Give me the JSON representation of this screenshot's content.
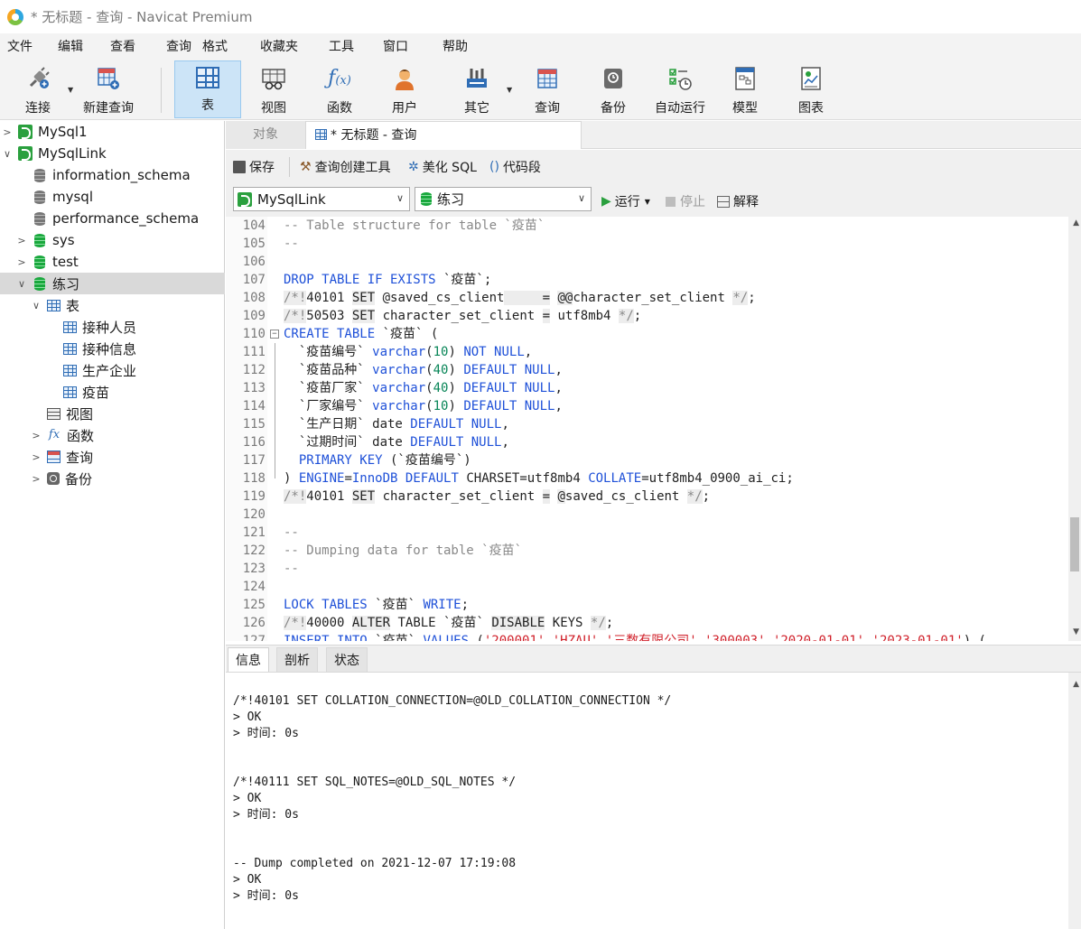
{
  "window": {
    "title": "* 无标题 - 查询 - Navicat Premium"
  },
  "menu": [
    "文件",
    "编辑",
    "查看",
    "查询",
    "格式",
    "收藏夹",
    "工具",
    "窗口",
    "帮助"
  ],
  "toolbar": {
    "connect": "连接",
    "new_query": "新建查询",
    "table": "表",
    "view": "视图",
    "function": "函数",
    "user": "用户",
    "other": "其它",
    "query": "查询",
    "backup": "备份",
    "auto_run": "自动运行",
    "model": "模型",
    "chart": "图表",
    "active": "表"
  },
  "tree": [
    {
      "label": "MySql1",
      "icon": "connection-icon",
      "expanded": false
    },
    {
      "label": "MySqlLink",
      "icon": "connection-icon",
      "expanded": true
    },
    {
      "label": "information_schema",
      "icon": "database-icon"
    },
    {
      "label": "mysql",
      "icon": "database-icon"
    },
    {
      "label": "performance_schema",
      "icon": "database-icon"
    },
    {
      "label": "sys",
      "icon": "database-active-icon",
      "expanded": false
    },
    {
      "label": "test",
      "icon": "database-active-icon",
      "expanded": false
    },
    {
      "label": "练习",
      "icon": "database-active-icon",
      "expanded": true,
      "selected": true
    },
    {
      "label": "表",
      "icon": "tables-icon",
      "expanded": true
    },
    {
      "label": "接种人员",
      "icon": "table-icon"
    },
    {
      "label": "接种信息",
      "icon": "table-icon"
    },
    {
      "label": "生产企业",
      "icon": "table-icon"
    },
    {
      "label": "疫苗",
      "icon": "table-icon"
    },
    {
      "label": "视图",
      "icon": "views-icon"
    },
    {
      "label": "函数",
      "icon": "function-icon",
      "expanded": false
    },
    {
      "label": "查询",
      "icon": "query-icon",
      "expanded": false
    },
    {
      "label": "备份",
      "icon": "backup-icon",
      "expanded": false
    }
  ],
  "tabs": {
    "objects": "对象",
    "query_tab": "* 无标题 - 查询"
  },
  "editor_toolbar": {
    "save": "保存",
    "query_builder": "查询创建工具",
    "beautify": "美化 SQL",
    "snippet": "代码段"
  },
  "selectors": {
    "connection": "MySqlLink",
    "database": "练习",
    "run": "运行",
    "stop": "停止",
    "explain": "解释"
  },
  "code_lines": [
    {
      "n": "104",
      "text": "-- Table structure for table `疫苗`"
    },
    {
      "n": "105",
      "text": "--"
    },
    {
      "n": "106",
      "text": ""
    },
    {
      "n": "107",
      "text": "DROP TABLE IF EXISTS `疫苗`;"
    },
    {
      "n": "108",
      "text": "/*!40101 SET @saved_cs_client     = @@character_set_client */;"
    },
    {
      "n": "109",
      "text": "/*!50503 SET character_set_client = utf8mb4 */;"
    },
    {
      "n": "110",
      "text": "CREATE TABLE `疫苗` ("
    },
    {
      "n": "111",
      "text": "  `疫苗编号` varchar(10) NOT NULL,"
    },
    {
      "n": "112",
      "text": "  `疫苗品种` varchar(40) DEFAULT NULL,"
    },
    {
      "n": "113",
      "text": "  `疫苗厂家` varchar(40) DEFAULT NULL,"
    },
    {
      "n": "114",
      "text": "  `厂家编号` varchar(10) DEFAULT NULL,"
    },
    {
      "n": "115",
      "text": "  `生产日期` date DEFAULT NULL,"
    },
    {
      "n": "116",
      "text": "  `过期时间` date DEFAULT NULL,"
    },
    {
      "n": "117",
      "text": "  PRIMARY KEY (`疫苗编号`)"
    },
    {
      "n": "118",
      "text": ") ENGINE=InnoDB DEFAULT CHARSET=utf8mb4 COLLATE=utf8mb4_0900_ai_ci;"
    },
    {
      "n": "119",
      "text": "/*!40101 SET character_set_client = @saved_cs_client */;"
    },
    {
      "n": "120",
      "text": ""
    },
    {
      "n": "121",
      "text": "--"
    },
    {
      "n": "122",
      "text": "-- Dumping data for table `疫苗`"
    },
    {
      "n": "123",
      "text": "--"
    },
    {
      "n": "124",
      "text": ""
    },
    {
      "n": "125",
      "text": "LOCK TABLES `疫苗` WRITE;"
    },
    {
      "n": "126",
      "text": "/*!40000 ALTER TABLE `疫苗` DISABLE KEYS */;"
    },
    {
      "n": "127",
      "text": "INSERT INTO `疫苗` VALUES ('200001','HZAU','三数有限公司','300003','2020-01-01','2023-01-01'),("
    }
  ],
  "bottom_tabs": [
    "信息",
    "剖析",
    "状态"
  ],
  "output_lines": [
    "/*!40101 SET COLLATION_CONNECTION=@OLD_COLLATION_CONNECTION */",
    "> OK",
    "> 时间: 0s",
    "",
    "",
    "/*!40111 SET SQL_NOTES=@OLD_SQL_NOTES */",
    "> OK",
    "> 时间: 0s",
    "",
    "",
    "-- Dump completed on 2021-12-07 17:19:08",
    "> OK",
    "> 时间: 0s"
  ]
}
